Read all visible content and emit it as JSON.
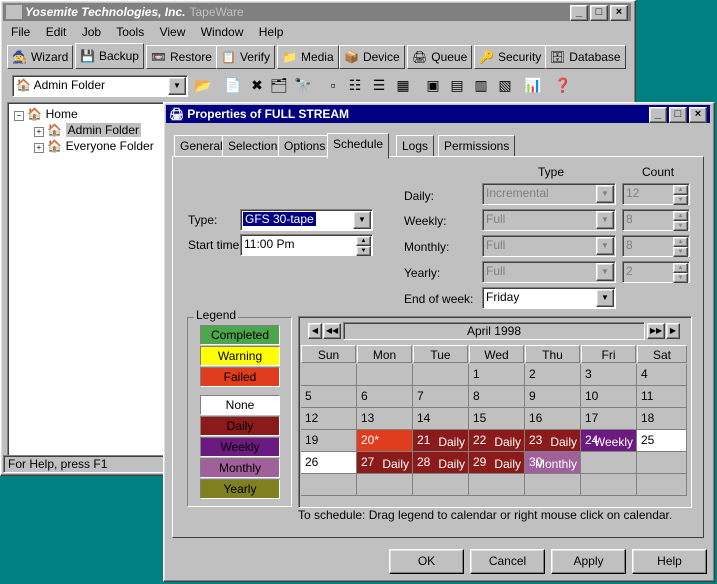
{
  "main_window": {
    "title_company": "Yosemite Technologies, Inc.",
    "title_app": "TapeWare",
    "menu": [
      "File",
      "Edit",
      "Job",
      "Tools",
      "View",
      "Window",
      "Help"
    ],
    "toolbar_tabs": [
      "Wizard",
      "Backup",
      "Restore",
      "Verify",
      "Media",
      "Device",
      "Queue",
      "Security",
      "Database"
    ],
    "folder_combo": "Admin Folder",
    "tree": {
      "root": "Home",
      "children": [
        "Admin Folder",
        "Everyone Folder"
      ]
    },
    "status": "For Help, press F1"
  },
  "dialog": {
    "title": "Properties of FULL STREAM",
    "tabs": [
      "General",
      "Selection",
      "Options",
      "Schedule",
      "Logs",
      "Permissions"
    ],
    "selected_tab": "Schedule",
    "type_label": "Type:",
    "type_value": "GFS 30-tape",
    "start_label": "Start time:",
    "start_value": "11:00 Pm",
    "col_type": "Type",
    "col_count": "Count",
    "rows": [
      {
        "label": "Daily:",
        "type": "Incremental",
        "count": "12"
      },
      {
        "label": "Weekly:",
        "type": "Full",
        "count": "8"
      },
      {
        "label": "Monthly:",
        "type": "Full",
        "count": "8"
      },
      {
        "label": "Yearly:",
        "type": "Full",
        "count": "2"
      }
    ],
    "end_week_label": "End of week:",
    "end_week_value": "Friday",
    "legend_title": "Legend",
    "legend": [
      {
        "label": "Completed",
        "color": "#4ca64c"
      },
      {
        "label": "Warning",
        "color": "#ffff00"
      },
      {
        "label": "Failed",
        "color": "#e03c1e"
      },
      {
        "label": "None",
        "color": "#ffffff"
      },
      {
        "label": "Daily",
        "color": "#8b1a1a"
      },
      {
        "label": "Weekly",
        "color": "#6b1a80"
      },
      {
        "label": "Monthly",
        "color": "#a0609a"
      },
      {
        "label": "Yearly",
        "color": "#808020"
      }
    ],
    "calendar": {
      "month": "April 1998",
      "days": [
        "Sun",
        "Mon",
        "Tue",
        "Wed",
        "Thu",
        "Fri",
        "Sat"
      ]
    },
    "hint": "To schedule: Drag legend to calendar or right mouse click on calendar.",
    "buttons": {
      "ok": "OK",
      "cancel": "Cancel",
      "apply": "Apply",
      "help": "Help"
    }
  }
}
